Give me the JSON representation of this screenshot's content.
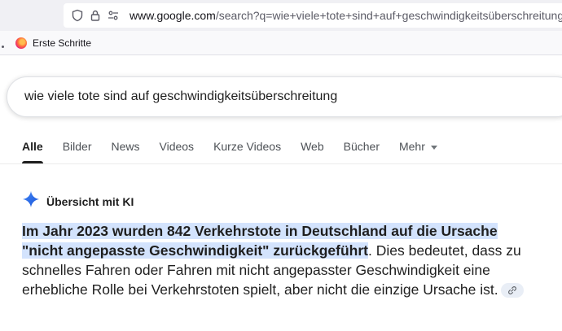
{
  "browser": {
    "url_host": "www.google.com",
    "url_path": "/search?q=wie+viele+tote+sind+auf+geschwindigkeitsüberschreitung",
    "bookmarks": [
      {
        "label": "Erste Schritte",
        "icon": "firefox-icon"
      }
    ]
  },
  "search": {
    "query": "wie viele tote sind auf geschwindigkeitsüberschreitung"
  },
  "tabs": [
    {
      "label": "Alle",
      "active": true
    },
    {
      "label": "Bilder"
    },
    {
      "label": "News"
    },
    {
      "label": "Videos"
    },
    {
      "label": "Kurze Videos"
    },
    {
      "label": "Web"
    },
    {
      "label": "Bücher"
    },
    {
      "label": "Mehr",
      "dropdown": true
    }
  ],
  "ai_overview": {
    "title": "Übersicht mit KI",
    "icon": "gemini-sparkle-icon",
    "highlight_text": " Im Jahr 2023 wurden 842 Verkehrstote in Deutschland auf die Ursache \"nicht angepasste Geschwindigkeit\" zurückgeführt",
    "body_text": ". Dies bedeutet, dass zu schnelles Fahren oder Fahren mit nicht angepasster Geschwindigkeit eine erhebliche Rolle bei Verkehrstoten spielt, aber nicht die einzige Ursache ist.",
    "link_icon": "link-icon"
  },
  "colors": {
    "highlight": "#d3e3fd",
    "sparkle_blue": "#1a73e8"
  }
}
